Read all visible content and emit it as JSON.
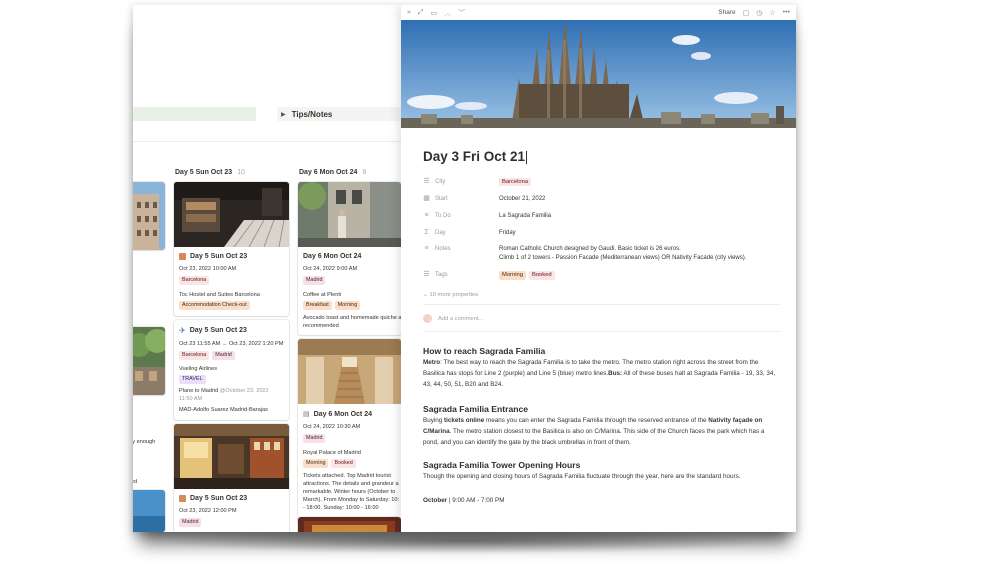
{
  "board": {
    "toggle_label": "Tips/Notes",
    "columns": [
      {
        "name": "Day 5 Sun Oct 23",
        "count": "10"
      },
      {
        "name": "Day 6 Mon Oct 24",
        "count": "8"
      }
    ],
    "clipped_text": {
      "line1": "ly enough",
      "line2": "ed"
    },
    "cards": {
      "c1": {
        "title": "Day 5 Sun Oct 23",
        "date": "Oct 23, 2022 10:00 AM",
        "tag1": "Barcelona",
        "line": "Toc Hostel and Suites Barcelona",
        "tag2": "Accommodation Check-out"
      },
      "c2": {
        "title": "Day 5 Sun Oct 23",
        "date": "Oct 23 11:55 AM → Oct 23, 2022 1:20 PM",
        "tag1": "Barcelona",
        "tag2": "Madrid",
        "line1": "Vueling Airlines",
        "tag3": "TRAVEL",
        "line2": "Plane to Madrid",
        "line2b": "@October 23, 2022",
        "line3": "11:50 AM",
        "line4": "MAD-Adolfo Suarez Madrid-Barajas"
      },
      "c3": {
        "title": "Day 5 Sun Oct 23",
        "date": "Oct 23, 2022 12:00 PM",
        "tag1": "Madrid"
      },
      "c4": {
        "title": "Day 6 Mon Oct 24",
        "date": "Oct 24, 2022 9:00 AM",
        "tag1": "Madrid",
        "line": "Coffee at Plenti",
        "tag2": "Breakfast",
        "tag3": "Morning",
        "note1": "Avocado toast and homemade quiche a",
        "note2": "recommended"
      },
      "c5": {
        "title": "Day 6 Mon Oct 24",
        "date": "Oct 24, 2022 10:30 AM",
        "tag1": "Madrid",
        "line": "Royal Palace of Madrid",
        "tag2": "Morning",
        "tag3": "Booked",
        "note1": "Tickets attached. Top Madrid tourist",
        "note2": "attractions. The details and grandeur a",
        "note3": "remarkable. Winter hours (October to",
        "note4": "March). From Monday to Saturday: 10:",
        "note5": "- 18:00. Sunday: 10:00 - 16:00"
      }
    }
  },
  "topbar": {
    "share": "Share"
  },
  "page": {
    "title": "Day 3 Fri Oct 21",
    "properties": [
      {
        "name": "City",
        "value": "Barcelona",
        "kind": "tag"
      },
      {
        "name": "Start",
        "value": "October 21, 2022",
        "kind": "text"
      },
      {
        "name": "To Do",
        "value": "La Sagrada Familia",
        "kind": "text"
      },
      {
        "name": "Day",
        "value": "Friday",
        "kind": "text"
      },
      {
        "name": "Notes",
        "value": "Roman Catholic Church designed by Gaudi. Basic ticket is 26 euros.",
        "value2": "Climb 1 of 2 towers - Passion Facade (Mediterranean views) OR Nativity Facade (city views).",
        "kind": "text"
      },
      {
        "name": "Tags",
        "value": "Morning",
        "value2": "Booked",
        "kind": "tags"
      }
    ],
    "more_properties": "10 more properties",
    "comment_placeholder": "Add a comment...",
    "sections": [
      {
        "heading": "How to reach Sagrada Familia",
        "p1a": "Metro",
        "p1b": ": The best way to reach the Sagrada Familia is to take the metro. The metro station right across the street from the Basilica has stops for Line 2 (purple) and Line 5 (blue) metro lines.",
        "p1c": "Bus:",
        "p1d": " All of these buses halt at Sagrada Familia - 19, 33, 34, 43, 44, 50, 51, B20 and B24."
      },
      {
        "heading": "Sagrada Familia Entrance",
        "p1a": "Buying ",
        "p1b": "tickets online",
        "p1c": " means you can enter the Sagrada Familia through the reserved entrance of the ",
        "p1d": "Nativity façade on C/Marina",
        "p1e": ". The metro station closest to the Basilica is also on C/Marina. This side of the Church faces the park which has a pond, and you can identify the gate by the black umbrellas in front of them."
      },
      {
        "heading": "Sagrada Familia Tower Opening Hours",
        "p1": "Though the opening and closing hours of Sagrada Familia fluctuate through the year, here are the standard hours.",
        "p2a": "October",
        "p2b": " | 9:00 AM - 7:00 PM"
      }
    ]
  }
}
